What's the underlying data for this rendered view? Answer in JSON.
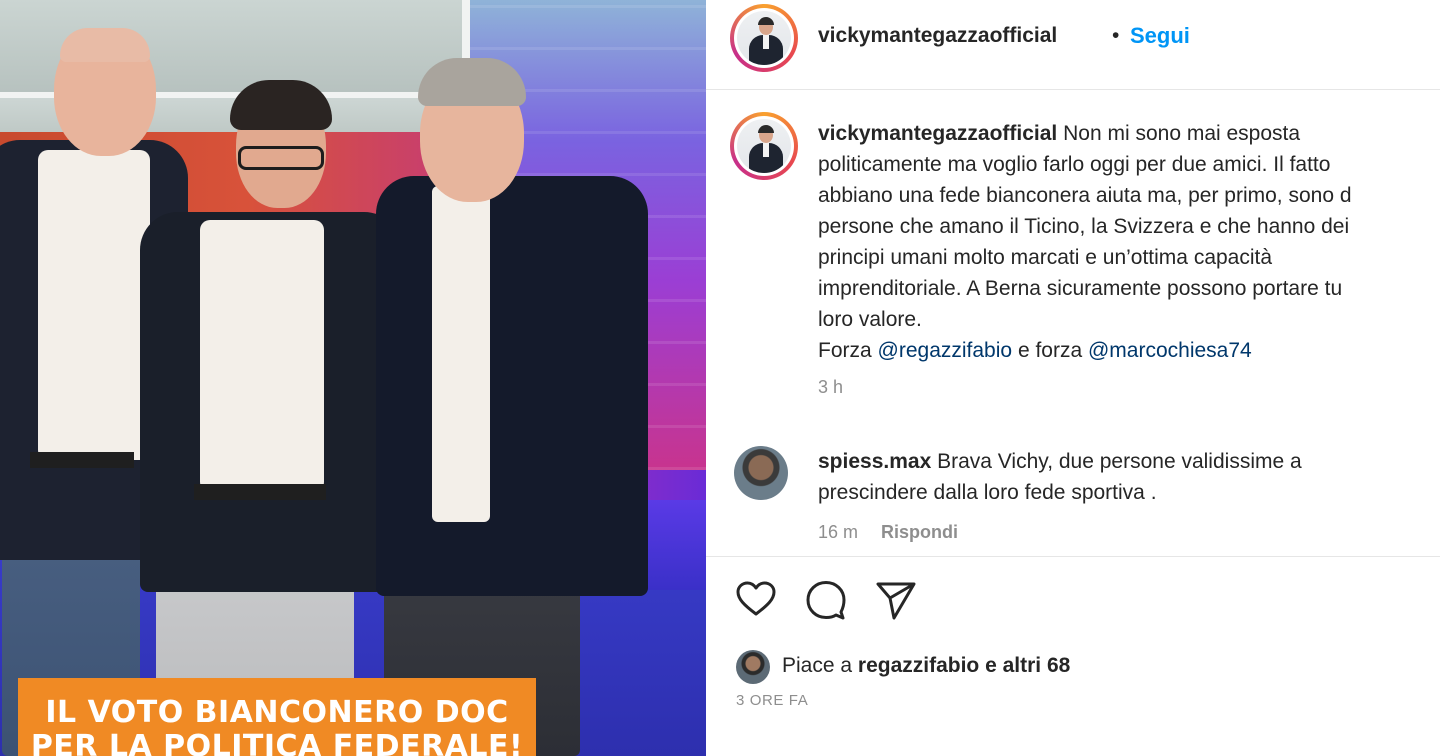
{
  "photo": {
    "caption_line1": "IL VOTO BIANCONERO DOC",
    "caption_line2": "PER LA POLITICA FEDERALE!"
  },
  "header": {
    "username": "vickymantegazzaofficial",
    "separator": "•",
    "follow_label": "Segui"
  },
  "post": {
    "author": "vickymantegazzaofficial",
    "text_line1": "Non mi sono mai esposta",
    "text_line2": "politicamente ma voglio farlo oggi per due amici. Il fatto",
    "text_line3": "abbiano una fede bianconera aiuta ma, per primo, sono d",
    "text_line4": "persone che amano il Ticino, la Svizzera e che hanno dei",
    "text_line5": "principi umani molto marcati e un’ottima capacità",
    "text_line6": "imprenditoriale. A Berna sicuramente possono portare tu",
    "text_line7": "loro valore.",
    "line8_prefix": "Forza",
    "mention1": "@regazzifabio",
    "line8_middle": "e forza",
    "mention2": "@marcochiesa74",
    "age": "3 h"
  },
  "comment": {
    "author": "spiess.max",
    "text_line1": "Brava Vichy, due persone validissime a",
    "text_line2": "prescindere dalla loro fede sportiva .",
    "age": "16 m",
    "reply_label": "Rispondi"
  },
  "actions": {
    "like_icon": "heart-icon",
    "comment_icon": "comment-bubble-icon",
    "share_icon": "send-icon"
  },
  "likes": {
    "prefix": "Piace a",
    "user": "regazzifabio",
    "suffix": "e altri 68"
  },
  "timestamp": "3 ORE FA",
  "colors": {
    "link": "#0095f6",
    "mention": "#00376b",
    "caption_bg": "#f08a24",
    "muted": "#8e8e8e"
  }
}
